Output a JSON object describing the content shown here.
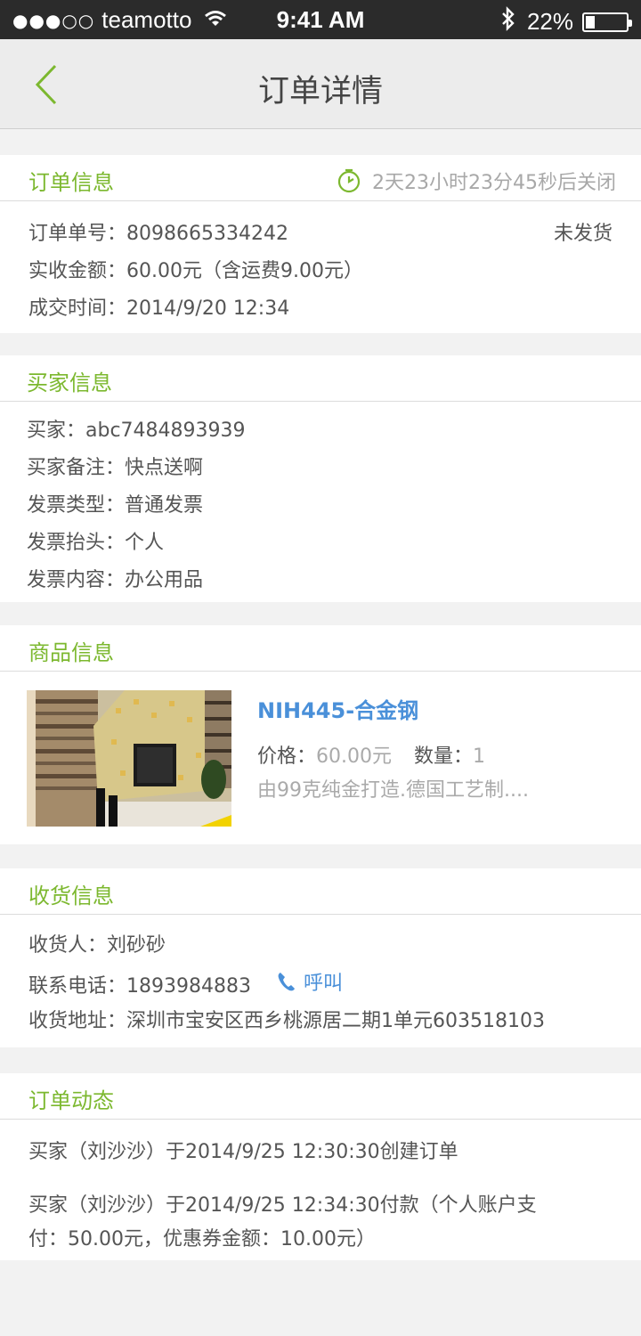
{
  "status_bar": {
    "signal": "●●●○○",
    "carrier": "teamotto",
    "time": "9:41 AM",
    "bluetooth": "✱",
    "battery_percent": "22%",
    "battery_level": 0.22
  },
  "nav": {
    "title": "订单详情"
  },
  "order_info": {
    "title": "订单信息",
    "countdown": "2天23小时23分45秒后关闭",
    "order_no_label": "订单单号：",
    "order_no": "8098665334242",
    "status": "未发货",
    "amount_label": "实收金额：",
    "amount": "60.00元（含运费9.00元）",
    "time_label": "成交时间：",
    "time": "2014/9/20 12:34"
  },
  "buyer_info": {
    "title": "买家信息",
    "buyer_label": "买家：",
    "buyer": "abc7484893939",
    "note_label": "买家备注：",
    "note": "快点送啊",
    "invoice_type_label": "发票类型：",
    "invoice_type": "普通发票",
    "invoice_header_label": "发票抬头：",
    "invoice_header": "个人",
    "invoice_content_label": "发票内容：",
    "invoice_content": "办公用品"
  },
  "product_info": {
    "title": "商品信息",
    "name": "NIH445-合金钢",
    "price_label": "价格：",
    "price": "60.00元",
    "qty_label": "数量：",
    "qty": "1",
    "desc": "由99克纯金打造.德国工艺制...."
  },
  "shipping_info": {
    "title": "收货信息",
    "receiver_label": "收货人：",
    "receiver": "刘砂砂",
    "phone_label": "联系电话：",
    "phone": "1893984883",
    "call_label": "呼叫",
    "address_label": "收货地址：",
    "address": "深圳市宝安区西乡桃源居二期1单元603518103"
  },
  "order_events": {
    "title": "订单动态",
    "event1": "买家（刘沙沙）于2014/9/25 12:30:30创建订单",
    "event2_line1": "买家（刘沙沙）于2014/9/25 12:34:30付款（个人账户支",
    "event2_line2": "付：50.00元，优惠券金额：10.00元）"
  },
  "colors": {
    "accent_green": "#7cb82f",
    "link_blue": "#4a90d9",
    "muted_gray": "#aaaaaa"
  }
}
